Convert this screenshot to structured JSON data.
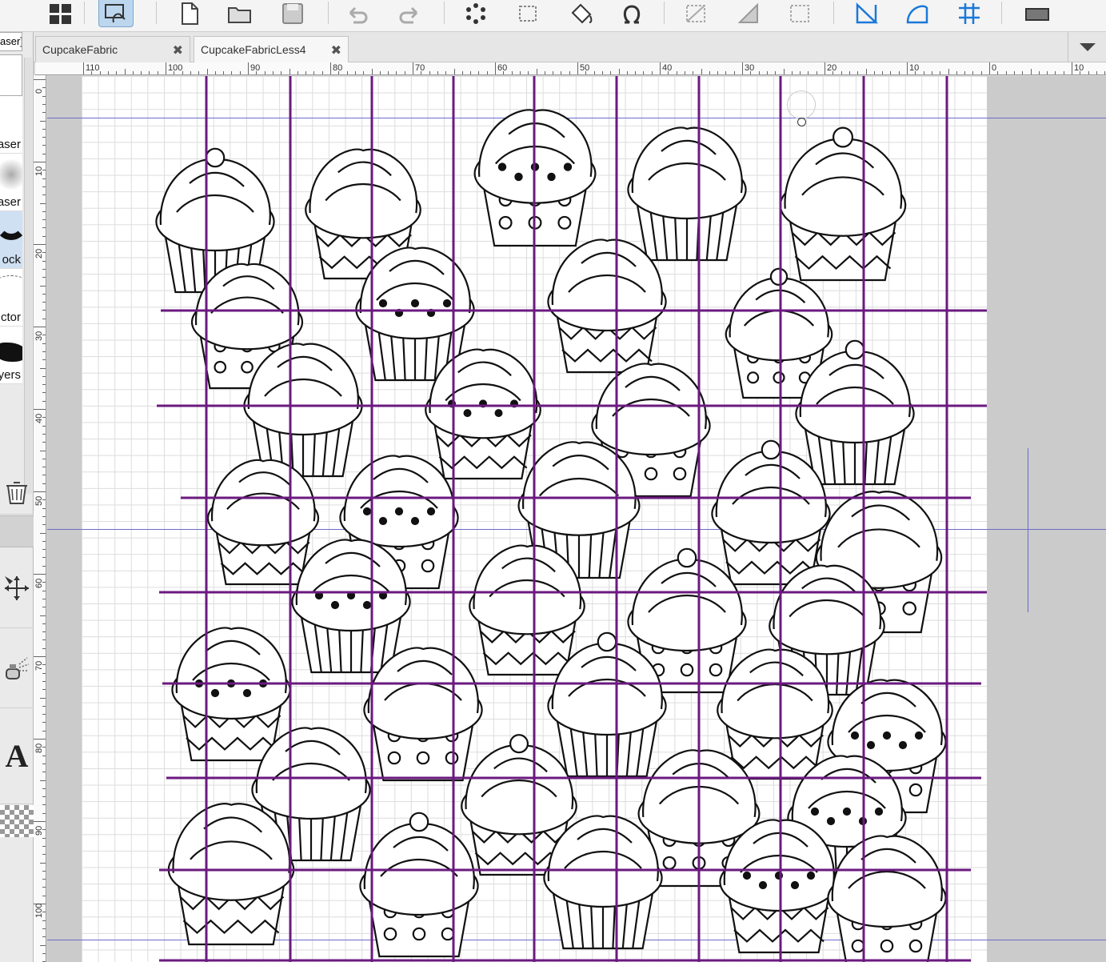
{
  "toolbar": {
    "buttons": [
      {
        "name": "layout-grid-icon"
      },
      {
        "name": "hand-draw-icon",
        "active": true
      },
      {
        "name": "new-file-icon"
      },
      {
        "name": "open-folder-icon"
      },
      {
        "name": "save-icon"
      },
      {
        "name": "undo-icon"
      },
      {
        "name": "redo-icon"
      },
      {
        "name": "spinner-icon"
      },
      {
        "name": "crop-icon"
      },
      {
        "name": "fill-bucket-icon"
      },
      {
        "name": "omega-icon"
      },
      {
        "name": "transform-icon"
      },
      {
        "name": "ruler-triangle-icon"
      },
      {
        "name": "selection-icon"
      },
      {
        "name": "perspective-icon"
      },
      {
        "name": "curve-ruler-icon"
      },
      {
        "name": "symmetry-icon"
      },
      {
        "name": "screen-mode-icon"
      }
    ]
  },
  "left_panel": {
    "top_label": "aser]",
    "brushes": [
      {
        "label": "aser"
      },
      {
        "label": "aser"
      },
      {
        "label": "ock",
        "selected": true
      },
      {
        "label": "ctor"
      },
      {
        "label": "yers"
      }
    ],
    "text_tool_glyph": "A"
  },
  "tabs": [
    {
      "label": "CupcakeFabric",
      "active": false
    },
    {
      "label": "CupcakeFabricLess4",
      "active": true
    }
  ],
  "ruler": {
    "h_labels": [
      "110",
      "100",
      "90",
      "80",
      "70",
      "60",
      "50",
      "40",
      "30",
      "20",
      "10",
      "0",
      "10"
    ],
    "v_labels": [
      "0",
      "10",
      "20",
      "30",
      "40",
      "50",
      "60",
      "70",
      "80",
      "90",
      "100"
    ]
  },
  "colors": {
    "grid_line": "#6b1a80",
    "guide": "#6c6cc8",
    "accent": "#1a78d8",
    "paper": "#ffffff"
  }
}
